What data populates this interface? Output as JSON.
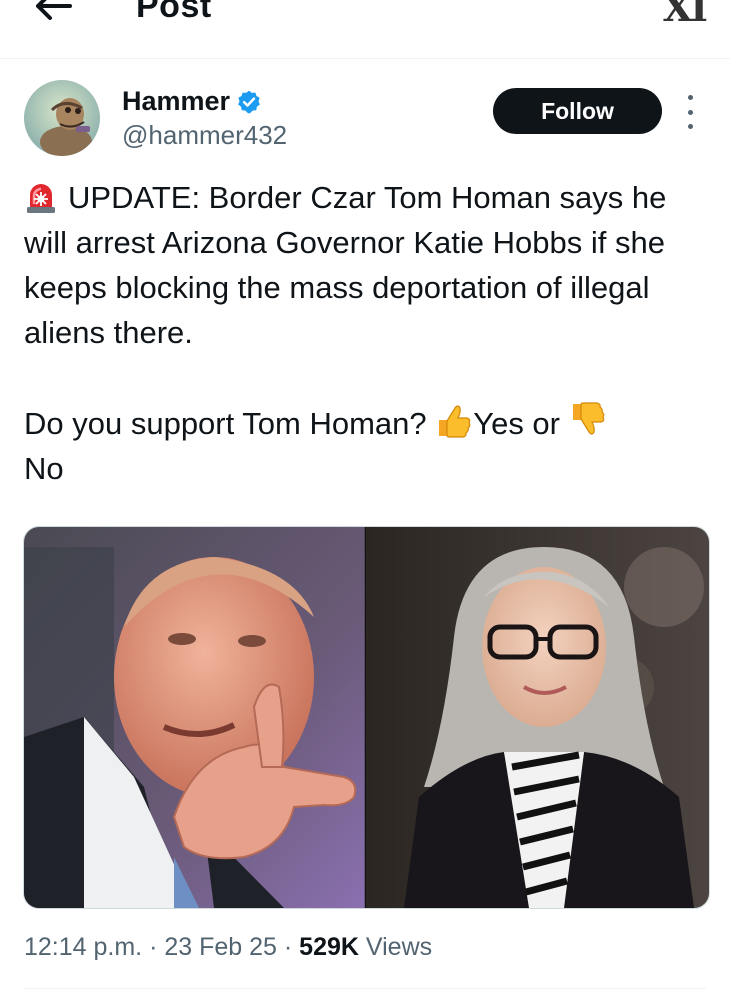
{
  "header": {
    "title": "Post",
    "logo_text": "XI",
    "back_icon": "arrow-left-icon"
  },
  "author": {
    "display_name": "Hammer",
    "handle": "@hammer432",
    "verified": true,
    "verified_color": "#1d9bf0",
    "follow_label": "Follow",
    "more_icon": "more-vertical-icon"
  },
  "tweet": {
    "line1_emoji": "siren-icon",
    "line1_text": "UPDATE: Border Czar Tom Homan says he will arrest Arizona Governor Katie Hobbs if she keeps blocking the mass deportation of illegal aliens there.",
    "line2_prefix": "Do you support Tom Homan? ",
    "line2_yes": "Yes or ",
    "line2_no": "No"
  },
  "meta": {
    "time": "12:14 p.m.",
    "sep1": " · ",
    "date": "23 Feb 25",
    "sep2": " · ",
    "views_count": "529K",
    "views_label": " Views"
  },
  "colors": {
    "follow_bg": "#0f1419",
    "secondary_text": "#536471"
  }
}
